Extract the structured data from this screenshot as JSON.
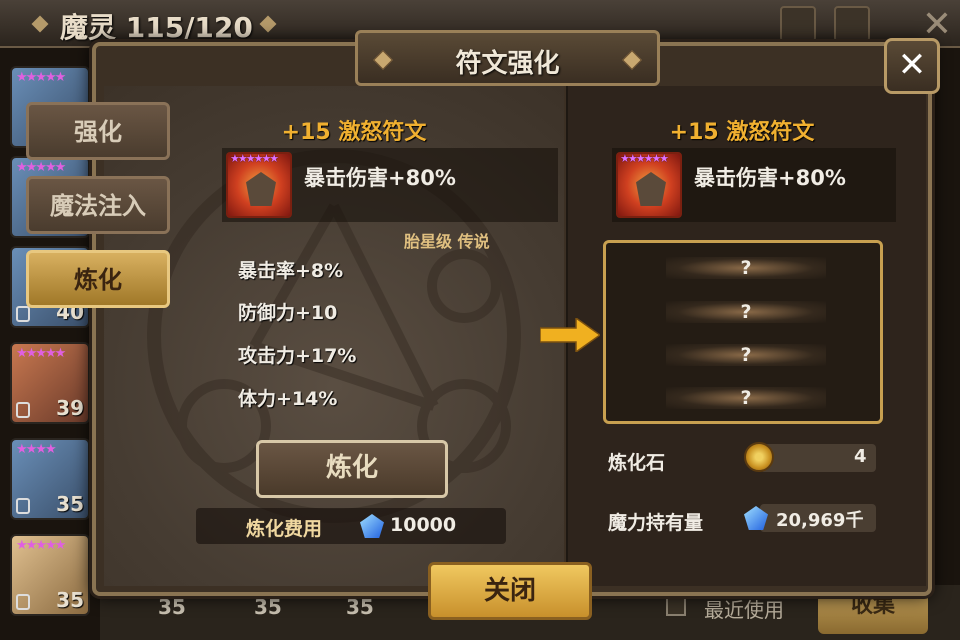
{
  "topbar": {
    "title": "魔灵 115/120"
  },
  "monsters": [
    {
      "level": ""
    },
    {
      "level": ""
    },
    {
      "level": "40"
    },
    {
      "level": "39"
    },
    {
      "level": "35"
    },
    {
      "level": "35"
    }
  ],
  "bottom_strip": {
    "levels": [
      "35",
      "35",
      "35"
    ],
    "recent_label": "最近使用",
    "collect_label": "收集"
  },
  "dialog": {
    "title": "符文强化",
    "close_x": "✕",
    "tabs": [
      {
        "label": "强化",
        "active": false
      },
      {
        "label": "魔法注入",
        "active": false
      },
      {
        "label": "炼化",
        "active": true
      }
    ],
    "current_rune": {
      "title": "+15 激怒符文",
      "main_stat": "暴击伤害+80%",
      "stars": "★★★★★★",
      "grade": "胎星级 传说",
      "substats": [
        "暴击率+8%",
        "防御力+10",
        "攻击力+17%",
        "体力+14%"
      ]
    },
    "refine_button": "炼化",
    "cost": {
      "label": "炼化费用",
      "value": "10000"
    },
    "result_rune": {
      "title": "+15 激怒符文",
      "main_stat": "暴击伤害+80%",
      "stars": "★★★★★★",
      "unknown_substats": [
        "?",
        "?",
        "?",
        "?"
      ]
    },
    "resources": [
      {
        "label": "炼化石",
        "value": "4"
      },
      {
        "label": "魔力持有量",
        "value": "20,969千"
      }
    ],
    "close_button": "关闭"
  },
  "colors": {
    "accent_gold": "#f0b030",
    "frame": "#8a7452",
    "stars": "#e070ff"
  }
}
